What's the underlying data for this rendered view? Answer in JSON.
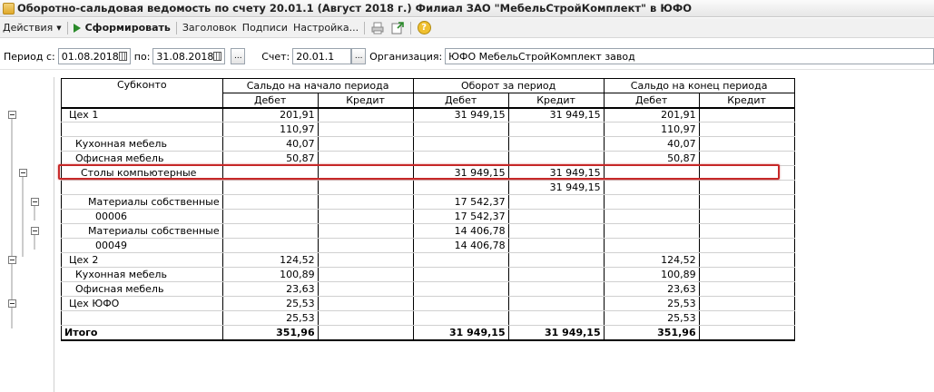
{
  "window": {
    "title": "Оборотно-сальдовая ведомость по счету 20.01.1 (Август 2018 г.) Филиал ЗАО \"МебельСтройКомплект\" в ЮФО"
  },
  "toolbar": {
    "actions_label": "Действия",
    "generate_label": "Сформировать",
    "header_label": "Заголовок",
    "signatures_label": "Подписи",
    "settings_label": "Настройка...",
    "help_symbol": "?"
  },
  "filters": {
    "period_from_label": "Период с:",
    "period_from_value": "01.08.2018",
    "period_to_label": "по:",
    "period_to_value": "31.08.2018",
    "ellipsis": "...",
    "account_label": "Счет:",
    "account_value": "20.01.1",
    "org_label": "Организация:",
    "org_value": "ЮФО МебельСтройКомплект завод"
  },
  "report": {
    "headers": {
      "subkonto": "Субконто",
      "opening": "Сальдо на начало периода",
      "turnover": "Оборот за период",
      "closing": "Сальдо на конец периода",
      "debit": "Дебет",
      "credit": "Кредит"
    },
    "rows": [
      [
        "Цех 1",
        "201,91",
        "",
        "31 949,15",
        "31 949,15",
        "201,91",
        ""
      ],
      [
        "",
        "110,97",
        "",
        "",
        "",
        "110,97",
        ""
      ],
      [
        "Кухонная мебель",
        "40,07",
        "",
        "",
        "",
        "40,07",
        ""
      ],
      [
        "Офисная мебель",
        "50,87",
        "",
        "",
        "",
        "50,87",
        ""
      ],
      [
        "Столы компьютерные",
        "",
        "",
        "31 949,15",
        "31 949,15",
        "",
        ""
      ],
      [
        "",
        "",
        "",
        "",
        "31 949,15",
        "",
        ""
      ],
      [
        "Материалы собственные",
        "",
        "",
        "17 542,37",
        "",
        "",
        ""
      ],
      [
        "00006",
        "",
        "",
        "17 542,37",
        "",
        "",
        ""
      ],
      [
        "Материалы собственные",
        "",
        "",
        "14 406,78",
        "",
        "",
        ""
      ],
      [
        "00049",
        "",
        "",
        "14 406,78",
        "",
        "",
        ""
      ],
      [
        "Цех 2",
        "124,52",
        "",
        "",
        "",
        "124,52",
        ""
      ],
      [
        "Кухонная мебель",
        "100,89",
        "",
        "",
        "",
        "100,89",
        ""
      ],
      [
        "Офисная мебель",
        "23,63",
        "",
        "",
        "",
        "23,63",
        ""
      ],
      [
        "Цех ЮФО",
        "25,53",
        "",
        "",
        "",
        "25,53",
        ""
      ],
      [
        "",
        "25,53",
        "",
        "",
        "",
        "25,53",
        ""
      ]
    ],
    "total": [
      "Итого",
      "351,96",
      "",
      "31 949,15",
      "31 949,15",
      "351,96",
      ""
    ]
  }
}
